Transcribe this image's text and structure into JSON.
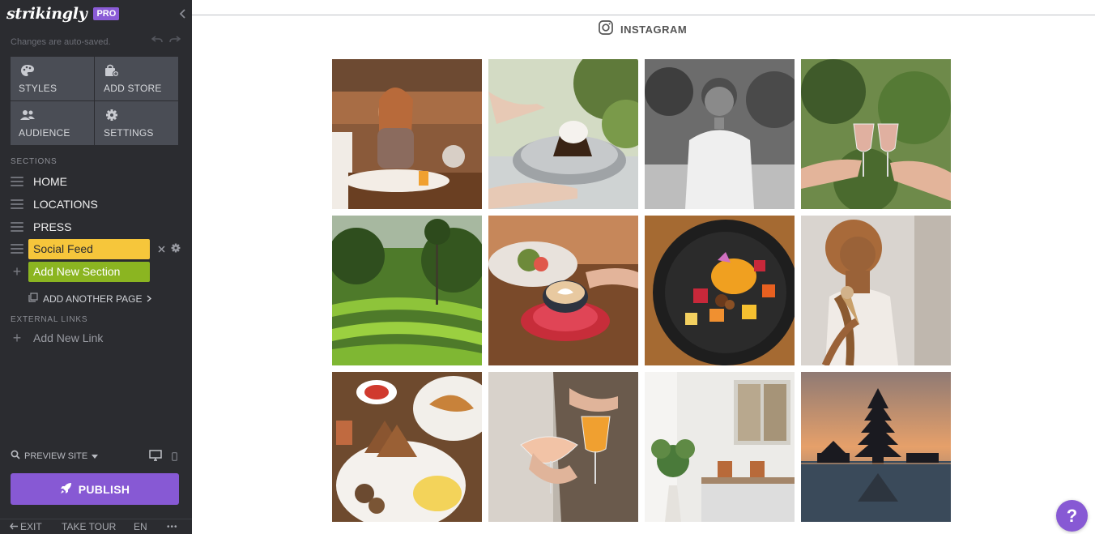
{
  "sidebar": {
    "brand": "strikingly",
    "plan_badge": "PRO",
    "autosave": "Changes are auto-saved.",
    "tools": [
      {
        "label": "STYLES",
        "icon": "palette-icon"
      },
      {
        "label": "ADD STORE",
        "icon": "store-icon"
      },
      {
        "label": "AUDIENCE",
        "icon": "audience-icon"
      },
      {
        "label": "SETTINGS",
        "icon": "gear-icon"
      }
    ],
    "sections_label": "SECTIONS",
    "sections": [
      {
        "label": "HOME"
      },
      {
        "label": "LOCATIONS"
      },
      {
        "label": "PRESS"
      },
      {
        "label": "Social Feed"
      }
    ],
    "add_section": "Add New Section",
    "add_page": "ADD ANOTHER PAGE",
    "external_links_label": "EXTERNAL LINKS",
    "add_link": "Add New Link",
    "preview": "PREVIEW SITE",
    "publish": "PUBLISH",
    "bottom": {
      "exit": "EXIT",
      "tour": "TAKE TOUR",
      "lang": "EN",
      "more": "•••"
    }
  },
  "main": {
    "feed_title": "INSTAGRAM",
    "photos": [
      {
        "alt": "woman dining at restaurant"
      },
      {
        "alt": "chocolate cake with ice cream"
      },
      {
        "alt": "portrait of chef in white shirt"
      },
      {
        "alt": "rosé wine glasses toast"
      },
      {
        "alt": "rice terraces jungle"
      },
      {
        "alt": "latte art coffee cup"
      },
      {
        "alt": "fruit salad bowl"
      },
      {
        "alt": "woman holding ice cream cone"
      },
      {
        "alt": "breakfast plates with croissant"
      },
      {
        "alt": "cocktails in hands"
      },
      {
        "alt": "restaurant interior with plants"
      },
      {
        "alt": "temple pagoda at sunset"
      }
    ],
    "help": "?"
  },
  "colors": {
    "sidebar_bg": "#2b2c30",
    "accent_purple": "#8759d4",
    "active_yellow": "#f6c63b",
    "add_green": "#8bb521"
  }
}
